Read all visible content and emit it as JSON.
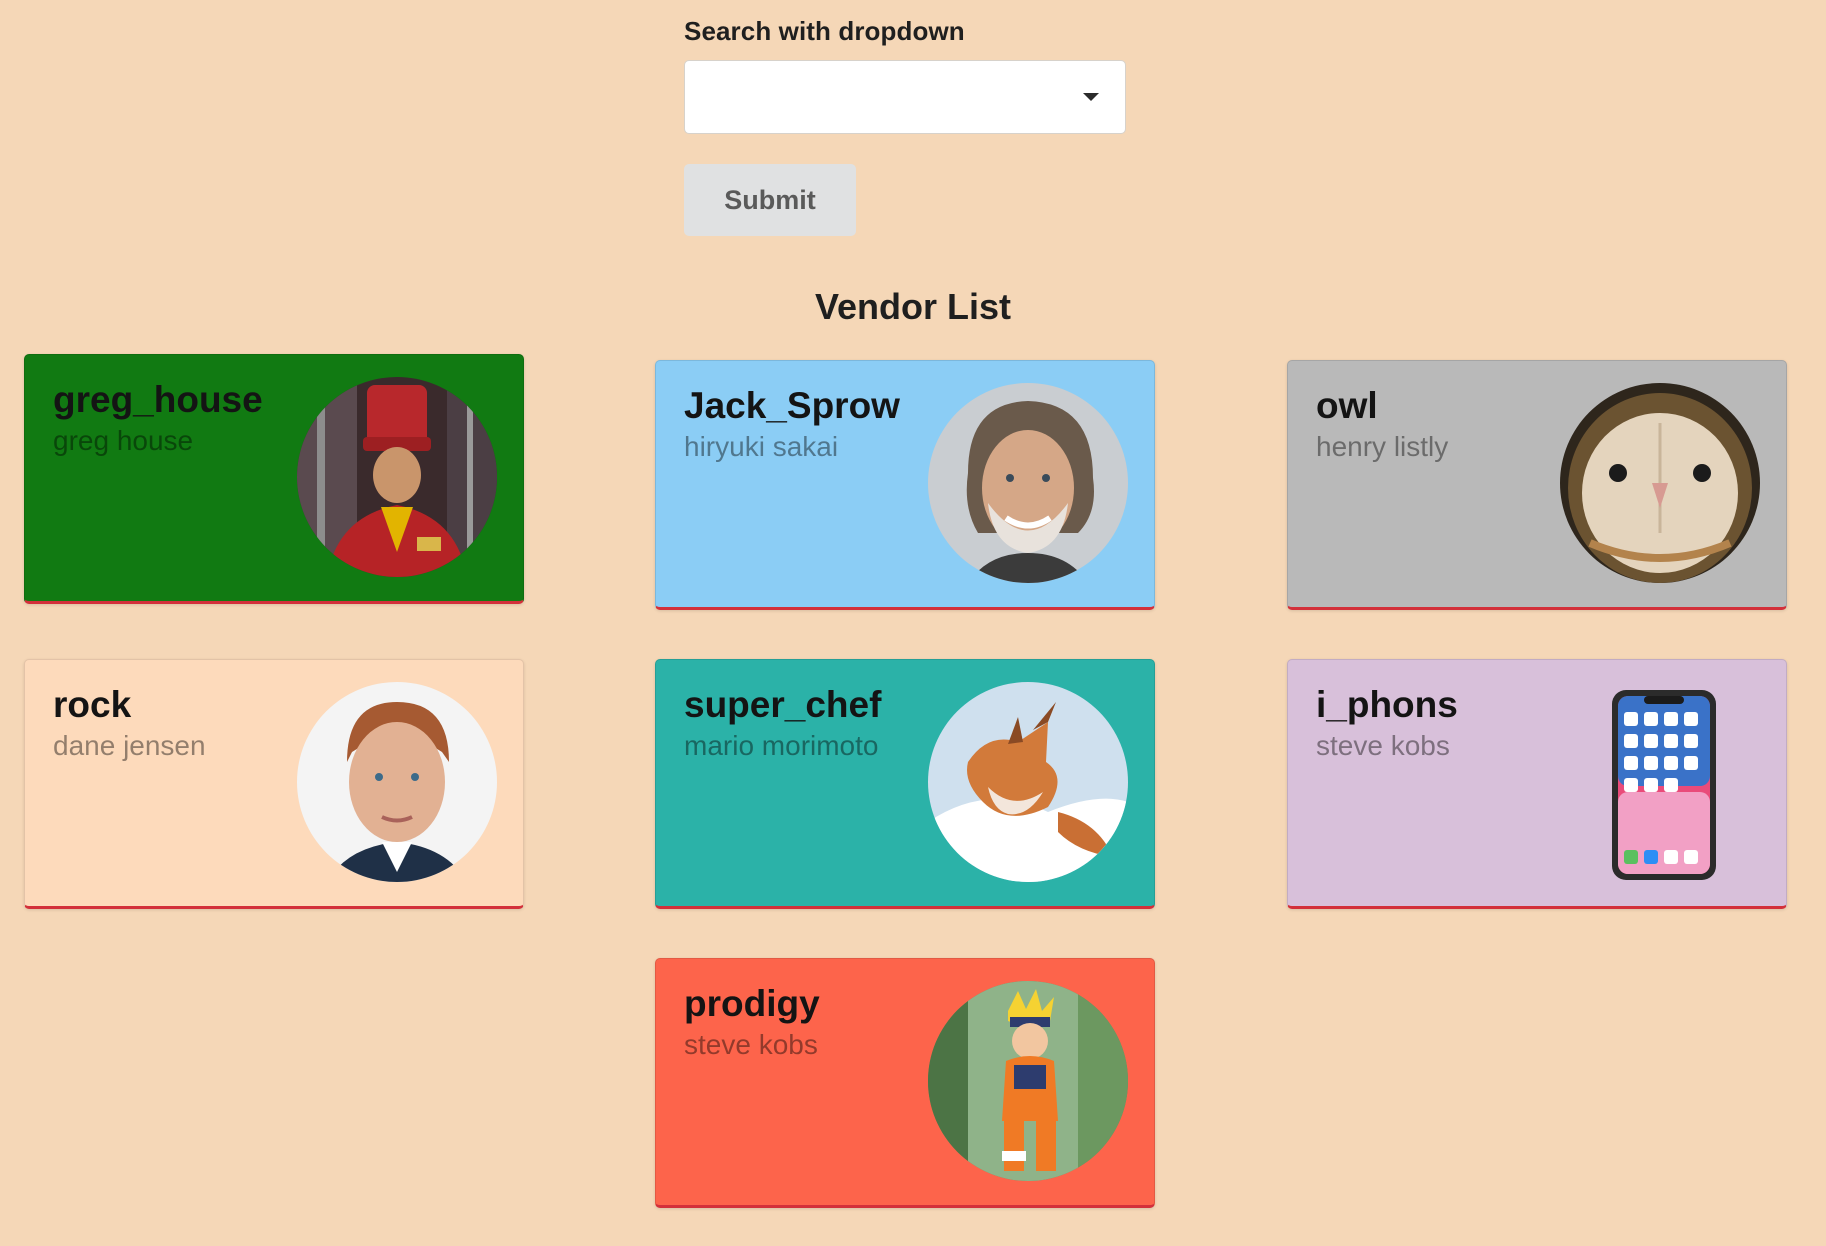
{
  "search": {
    "label": "Search with dropdown",
    "selected": ""
  },
  "submit_label": "Submit",
  "list_title": "Vendor List",
  "colors": {
    "page_bg": "#f5d7b7",
    "card_bottom_border": "#d3303a"
  },
  "vendors": [
    {
      "username": "greg_house",
      "name": "greg house",
      "color": "#117a12",
      "avatar": "chef-with-red-hat-photo"
    },
    {
      "username": "Jack_Sprow",
      "name": "hiryuki sakai",
      "color": "#8bcdf5",
      "avatar": "smiling-gray-haired-man-photo"
    },
    {
      "username": "owl",
      "name": "henry listly",
      "color": "#b9b9b9",
      "avatar": "barn-owl-photo"
    },
    {
      "username": "rock",
      "name": "dane jensen",
      "color": "#fddabb",
      "avatar": "red-haired-man-photo"
    },
    {
      "username": "super_chef",
      "name": "mario morimoto",
      "color": "#2bb2a8",
      "avatar": "fox-in-snow-photo"
    },
    {
      "username": "i_phons",
      "name": "steve kobs",
      "color": "#d8c0da",
      "avatar": "smartphone-image"
    },
    {
      "username": "prodigy",
      "name": "steve kobs",
      "color": "#fd644b",
      "avatar": "anime-ninja-character-image"
    }
  ]
}
